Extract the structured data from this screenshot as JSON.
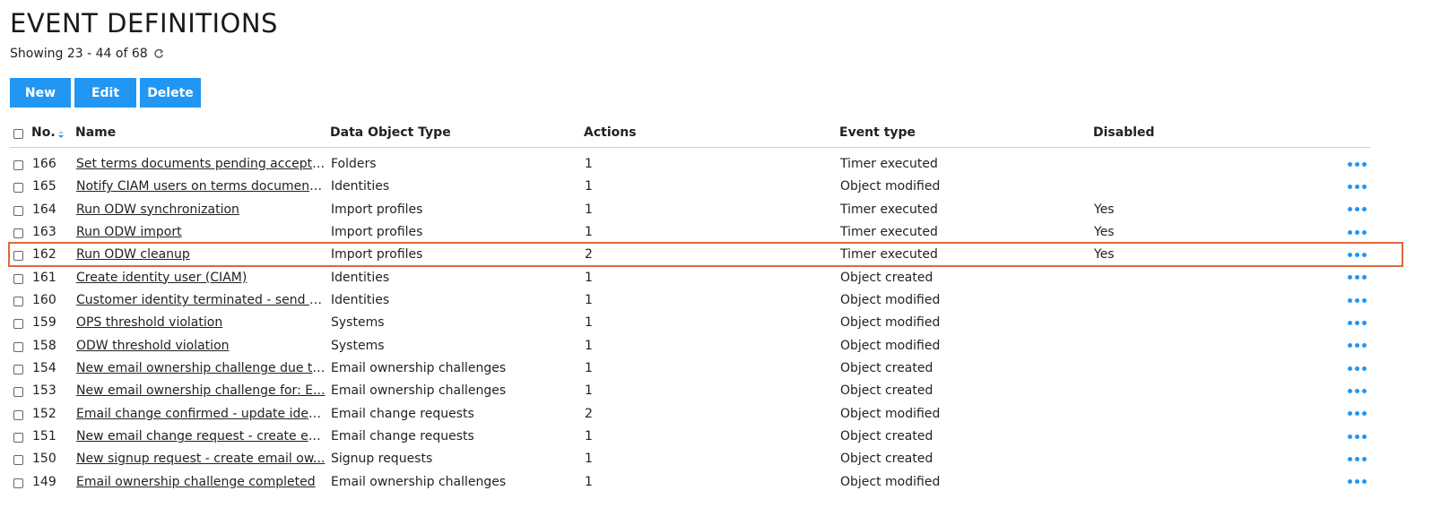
{
  "page": {
    "title": "EVENT DEFINITIONS",
    "showing": "Showing 23 - 44 of 68"
  },
  "toolbar": {
    "new_label": "New",
    "edit_label": "Edit",
    "delete_label": "Delete"
  },
  "colors": {
    "accent": "#2196f3",
    "highlight_border": "#e0683c"
  },
  "table": {
    "columns": {
      "no": "No.",
      "name": "Name",
      "data_object_type": "Data Object Type",
      "actions": "Actions",
      "event_type": "Event type",
      "disabled": "Disabled"
    },
    "sort_column": "No.",
    "rows": [
      {
        "no": "166",
        "name": "Set terms documents pending accepta...",
        "type": "Folders",
        "actions": "1",
        "event": "Timer executed",
        "disabled": ""
      },
      {
        "no": "165",
        "name": "Notify CIAM users on terms document...",
        "type": "Identities",
        "actions": "1",
        "event": "Object modified",
        "disabled": ""
      },
      {
        "no": "164",
        "name": "Run ODW synchronization",
        "type": "Import profiles",
        "actions": "1",
        "event": "Timer executed",
        "disabled": "Yes"
      },
      {
        "no": "163",
        "name": "Run ODW import",
        "type": "Import profiles",
        "actions": "1",
        "event": "Timer executed",
        "disabled": "Yes"
      },
      {
        "no": "162",
        "name": "Run ODW cleanup",
        "type": "Import profiles",
        "actions": "2",
        "event": "Timer executed",
        "disabled": "Yes"
      },
      {
        "no": "161",
        "name": "Create identity user (CIAM)",
        "type": "Identities",
        "actions": "1",
        "event": "Object created",
        "disabled": ""
      },
      {
        "no": "160",
        "name": "Customer identity terminated - send e...",
        "type": "Identities",
        "actions": "1",
        "event": "Object modified",
        "disabled": ""
      },
      {
        "no": "159",
        "name": "OPS threshold violation",
        "type": "Systems",
        "actions": "1",
        "event": "Object modified",
        "disabled": ""
      },
      {
        "no": "158",
        "name": "ODW threshold violation",
        "type": "Systems",
        "actions": "1",
        "event": "Object modified",
        "disabled": ""
      },
      {
        "no": "154",
        "name": "New email ownership challenge due to...",
        "type": "Email ownership challenges",
        "actions": "1",
        "event": "Object created",
        "disabled": ""
      },
      {
        "no": "153",
        "name": "New email ownership challenge for: E...",
        "type": "Email ownership challenges",
        "actions": "1",
        "event": "Object created",
        "disabled": ""
      },
      {
        "no": "152",
        "name": "Email change confirmed - update ident...",
        "type": "Email change requests",
        "actions": "2",
        "event": "Object modified",
        "disabled": ""
      },
      {
        "no": "151",
        "name": "New email change request - create em...",
        "type": "Email change requests",
        "actions": "1",
        "event": "Object created",
        "disabled": ""
      },
      {
        "no": "150",
        "name": "New signup request - create email ow...",
        "type": "Signup requests",
        "actions": "1",
        "event": "Object created",
        "disabled": ""
      },
      {
        "no": "149",
        "name": "Email ownership challenge completed",
        "type": "Email ownership challenges",
        "actions": "1",
        "event": "Object modified",
        "disabled": ""
      }
    ],
    "highlighted_row_no": "162"
  }
}
